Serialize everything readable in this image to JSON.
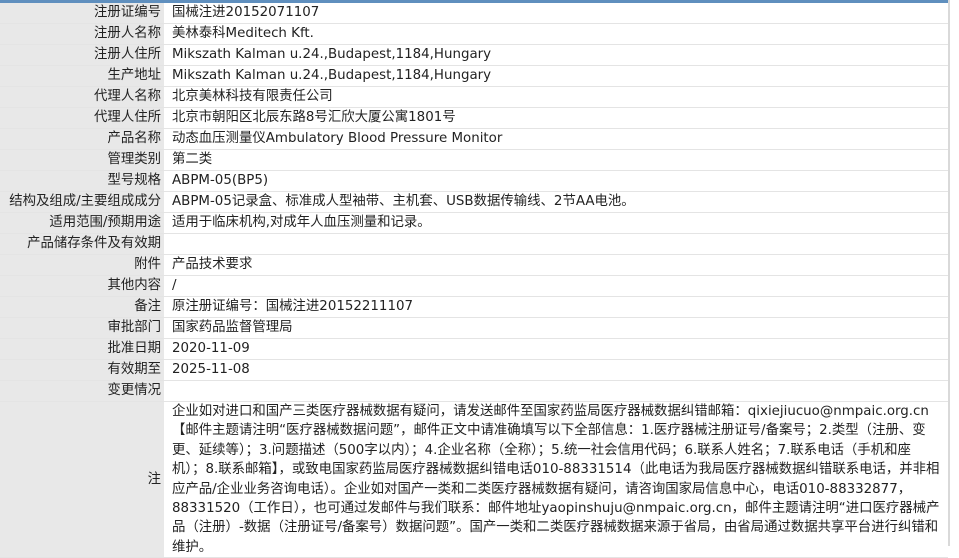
{
  "rows": [
    {
      "key": "reg_no",
      "label": "注册证编号",
      "value": "国械注进20152071107"
    },
    {
      "key": "registrant_name",
      "label": "注册人名称",
      "value": "美林泰科Meditech Kft."
    },
    {
      "key": "registrant_address",
      "label": "注册人住所",
      "value": "Mikszath Kalman u.24.,Budapest,1184,Hungary"
    },
    {
      "key": "production_address",
      "label": "生产地址",
      "value": "Mikszath Kalman u.24.,Budapest,1184,Hungary"
    },
    {
      "key": "agent_name",
      "label": "代理人名称",
      "value": "北京美林科技有限责任公司"
    },
    {
      "key": "agent_address",
      "label": "代理人住所",
      "value": "北京市朝阳区北辰东路8号汇欣大厦公寓1801号"
    },
    {
      "key": "product_name",
      "label": "产品名称",
      "value": "动态血压测量仪Ambulatory Blood Pressure Monitor"
    },
    {
      "key": "management_class",
      "label": "管理类别",
      "value": "第二类"
    },
    {
      "key": "model",
      "label": "型号规格",
      "value": "ABPM-05(BP5)"
    },
    {
      "key": "composition",
      "label": "结构及组成/主要组成成分",
      "value": "ABPM-05记录盒、标准成人型袖带、主机套、USB数据传输线、2节AA电池。"
    },
    {
      "key": "intended_use",
      "label": "适用范围/预期用途",
      "value": "适用于临床机构,对成年人血压测量和记录。"
    },
    {
      "key": "storage",
      "label": "产品储存条件及有效期",
      "value": ""
    },
    {
      "key": "attachment",
      "label": "附件",
      "value": "产品技术要求"
    },
    {
      "key": "other",
      "label": "其他内容",
      "value": "/"
    },
    {
      "key": "remark",
      "label": "备注",
      "value": "原注册证编号：国械注进20152211107"
    },
    {
      "key": "approval_dept",
      "label": "审批部门",
      "value": "国家药品监督管理局"
    },
    {
      "key": "approval_date",
      "label": "批准日期",
      "value": "2020-11-09"
    },
    {
      "key": "expiry_date",
      "label": "有效期至",
      "value": "2025-11-08"
    },
    {
      "key": "change_info",
      "label": "变更情况",
      "value": ""
    }
  ],
  "note": {
    "label": "注",
    "text": "企业如对进口和国产三类医疗器械数据有疑问，请发送邮件至国家药监局医疗器械数据纠错邮箱：qixiejiucuo@nmpaic.org.cn【邮件主题请注明“医疗器械数据问题”，邮件正文中请准确填写以下全部信息：1.医疗器械注册证号/备案号；2.类型（注册、变更、延续等）；3.问题描述（500字以内）；4.企业名称（全称）；5.统一社会信用代码；6.联系人姓名；7.联系电话（手机和座机）；8.联系邮箱】，或致电国家药监局医疗器械数据纠错电话010-88331514（此电话为我局医疗器械数据纠错联系电话，并非相应产品/企业业务咨询电话）。企业如对国产一类和二类医疗器械数据有疑问，请咨询国家局信息中心，电话010-88332877，88331520（工作日），也可通过发邮件与我们联系：邮件地址yaopinshuju@nmpaic.org.cn，邮件主题请注明“进口医疗器械产品（注册）-数据（注册证号/备案号）数据问题”。国产一类和二类医疗器械数据来源于省局，由省局通过数据共享平台进行纠错和维护。"
  },
  "colors": {
    "label_bg": "#e8e8e8",
    "top_bar": "#5f8fbe"
  }
}
